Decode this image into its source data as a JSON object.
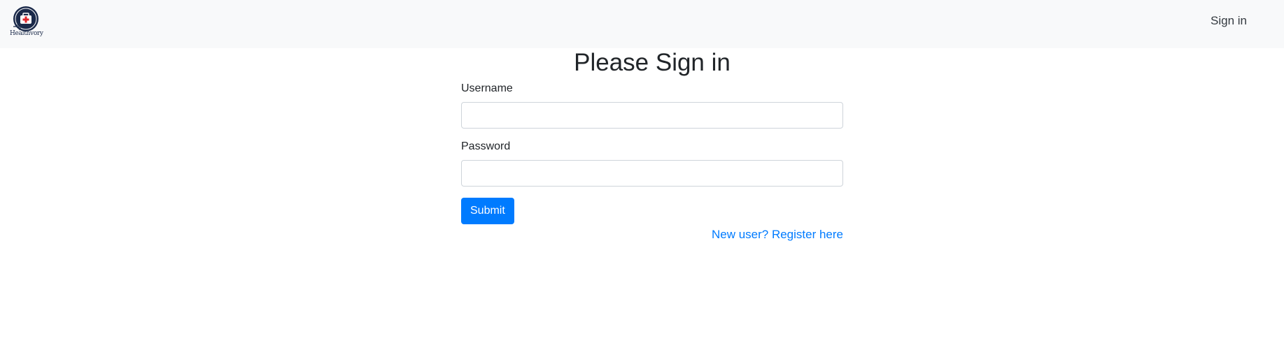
{
  "navbar": {
    "logo_text": "Healthvory",
    "signin_label": "Sign in"
  },
  "form": {
    "title": "Please Sign in",
    "username_label": "Username",
    "username_value": "",
    "password_label": "Password",
    "password_value": "",
    "submit_label": "Submit",
    "register_link": "New user? Register here"
  },
  "colors": {
    "navbar_bg": "#f8f9fa",
    "primary": "#007bff",
    "logo_navy": "#1b2a4a",
    "logo_red": "#e0262b"
  }
}
